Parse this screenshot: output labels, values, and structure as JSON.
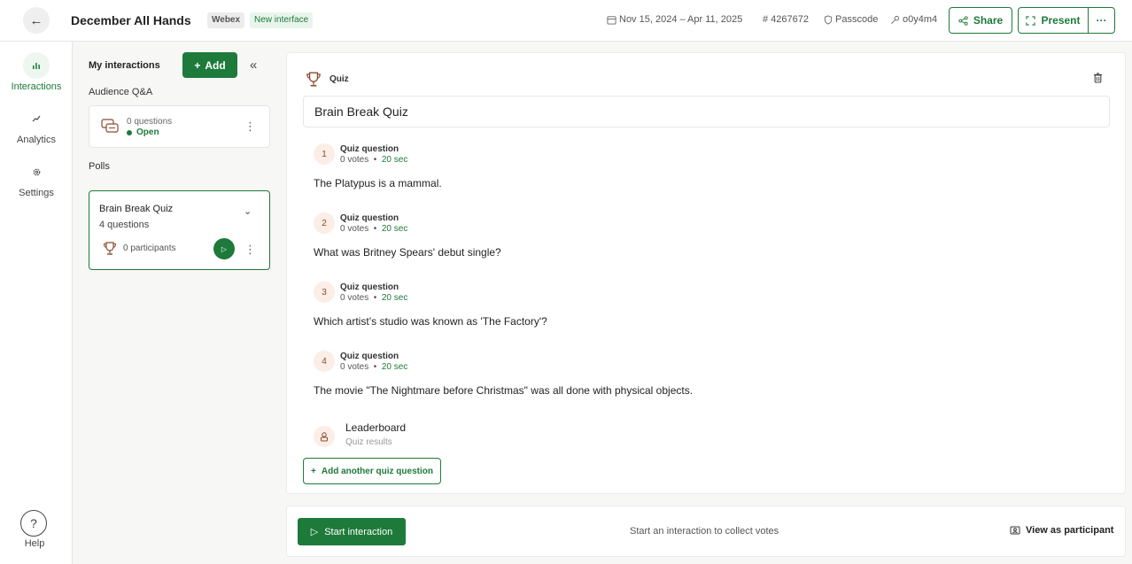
{
  "header": {
    "back_icon": "arrow-left-icon",
    "title": "December All Hands",
    "tag_webex": "Webex",
    "tag_new": "New interface",
    "dates": "Nov 15, 2024 – Apr 11, 2025",
    "event_id": "# 4267672",
    "passcode_label": "Passcode",
    "passcode_value": "o0y4m4",
    "share_label": "Share",
    "present_label": "Present",
    "more_label": "···"
  },
  "rail": {
    "items": [
      {
        "label": "Interactions",
        "icon": "bar-chart-icon",
        "active": true
      },
      {
        "label": "Analytics",
        "icon": "trend-icon",
        "active": false
      },
      {
        "label": "Settings",
        "icon": "gear-icon",
        "active": false
      }
    ],
    "help_label": "Help",
    "help_icon": "question-icon"
  },
  "sidebar": {
    "title": "My interactions",
    "add_label": "Add",
    "qa_section": "Audience Q&A",
    "qa_card": {
      "count": "0 questions",
      "status": "Open"
    },
    "polls_section": "Polls",
    "poll_card": {
      "name": "Brain Break Quiz",
      "questions": "4 questions",
      "participants": "0 participants"
    }
  },
  "main": {
    "type_label": "Quiz",
    "quiz_title": "Brain Break Quiz",
    "questions": [
      {
        "num": "1",
        "type": "Quiz question",
        "votes": "0 votes",
        "time": "20 sec",
        "text": "The Platypus is a mammal."
      },
      {
        "num": "2",
        "type": "Quiz question",
        "votes": "0 votes",
        "time": "20 sec",
        "text": "What was Britney Spears' debut single?"
      },
      {
        "num": "3",
        "type": "Quiz question",
        "votes": "0 votes",
        "time": "20 sec",
        "text": "Which artist’s studio was known as 'The Factory'?"
      },
      {
        "num": "4",
        "type": "Quiz question",
        "votes": "0 votes",
        "time": "20 sec",
        "text": "The movie \"The Nightmare before Christmas\" was all done with physical objects."
      }
    ],
    "leaderboard_title": "Leaderboard",
    "leaderboard_sub": "Quiz results",
    "add_question_label": "Add another quiz question"
  },
  "bottom": {
    "start_label": "Start interaction",
    "hint": "Start an interaction to collect votes",
    "view_label": "View as participant"
  },
  "colors": {
    "accent": "#1e7a3a",
    "accent_light": "#eef6f0",
    "quiz_badge": "#fbeee7",
    "quiz_icon": "#8a4a2e"
  }
}
